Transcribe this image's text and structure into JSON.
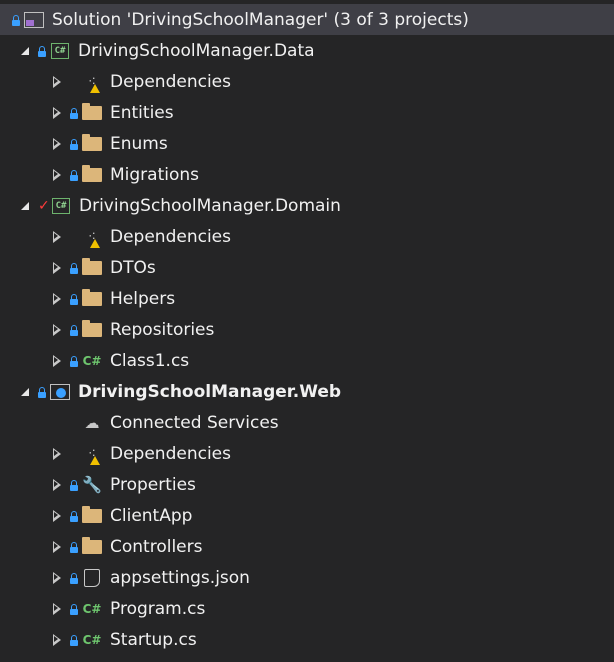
{
  "solution": {
    "label": "Solution 'DrivingSchoolManager' (3 of 3 projects)",
    "icon": "solution-icon"
  },
  "tree": [
    {
      "label": "DrivingSchoolManager.Data",
      "icon": "csharp-project-icon",
      "state": "expanded",
      "status": "lock"
    },
    {
      "label": "Dependencies",
      "icon": "dependencies-warning-icon",
      "state": "collapsed",
      "status": "none"
    },
    {
      "label": "Entities",
      "icon": "folder-icon",
      "state": "collapsed",
      "status": "lock"
    },
    {
      "label": "Enums",
      "icon": "folder-icon",
      "state": "collapsed",
      "status": "lock"
    },
    {
      "label": "Migrations",
      "icon": "folder-icon",
      "state": "collapsed",
      "status": "lock"
    },
    {
      "label": "DrivingSchoolManager.Domain",
      "icon": "csharp-project-icon",
      "state": "expanded",
      "status": "check"
    },
    {
      "label": "Dependencies",
      "icon": "dependencies-warning-icon",
      "state": "collapsed",
      "status": "none"
    },
    {
      "label": "DTOs",
      "icon": "folder-icon",
      "state": "collapsed",
      "status": "lock"
    },
    {
      "label": "Helpers",
      "icon": "folder-icon",
      "state": "collapsed",
      "status": "lock"
    },
    {
      "label": "Repositories",
      "icon": "folder-icon",
      "state": "collapsed",
      "status": "lock"
    },
    {
      "label": "Class1.cs",
      "icon": "csharp-file-icon",
      "state": "collapsed",
      "status": "lock"
    },
    {
      "label": "DrivingSchoolManager.Web",
      "icon": "web-project-icon",
      "state": "expanded",
      "status": "lock",
      "bold": true
    },
    {
      "label": "Connected Services",
      "icon": "connected-services-icon",
      "state": "none",
      "status": "none"
    },
    {
      "label": "Dependencies",
      "icon": "dependencies-warning-icon",
      "state": "collapsed",
      "status": "none"
    },
    {
      "label": "Properties",
      "icon": "wrench-icon",
      "state": "collapsed",
      "status": "lock"
    },
    {
      "label": "ClientApp",
      "icon": "folder-icon",
      "state": "collapsed",
      "status": "lock"
    },
    {
      "label": "Controllers",
      "icon": "folder-icon",
      "state": "collapsed",
      "status": "lock"
    },
    {
      "label": "appsettings.json",
      "icon": "json-file-icon",
      "state": "collapsed",
      "status": "lock"
    },
    {
      "label": "Program.cs",
      "icon": "csharp-file-icon",
      "state": "collapsed",
      "status": "lock"
    },
    {
      "label": "Startup.cs",
      "icon": "csharp-file-icon",
      "state": "collapsed",
      "status": "lock"
    }
  ]
}
